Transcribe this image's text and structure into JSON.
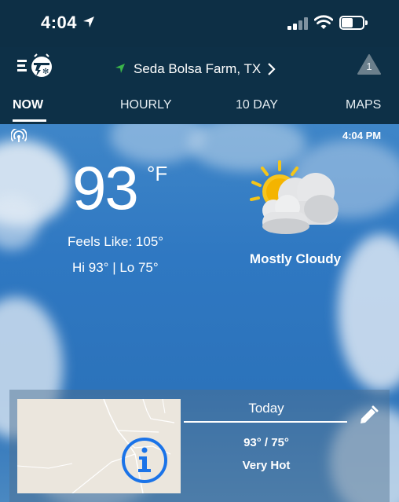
{
  "status_bar": {
    "time": "4:04",
    "icons": [
      "location-arrow-icon",
      "cellular-signal-icon",
      "wifi-icon",
      "battery-icon"
    ]
  },
  "header": {
    "location": "Seda Bolsa Farm, TX",
    "alert_count": "1",
    "icons": [
      "menu-logo-icon",
      "location-marker-icon",
      "chevron-right-icon",
      "alert-triangle-icon"
    ]
  },
  "tabs": [
    {
      "label": "NOW",
      "active": true
    },
    {
      "label": "HOURLY",
      "active": false
    },
    {
      "label": "10 DAY",
      "active": false
    },
    {
      "label": "MAPS",
      "active": false
    }
  ],
  "current": {
    "observed_time": "4:04 PM",
    "temperature": "93",
    "unit": "°F",
    "feels_like": "Feels Like: 105°",
    "hi_lo": "Hi 93° | Lo 75°",
    "condition": "Mostly Cloudy",
    "condition_icon": "partly-cloudy-icon"
  },
  "today_card": {
    "label": "Today",
    "temps": "93° / 75°",
    "description": "Very Hot",
    "icons": [
      "info-icon",
      "edit-pencil-icon"
    ]
  },
  "colors": {
    "header_bg": "#0d3047",
    "sky_blue": "#2f78c2",
    "info_blue": "#1a73e8",
    "location_green": "#3bb54a"
  }
}
